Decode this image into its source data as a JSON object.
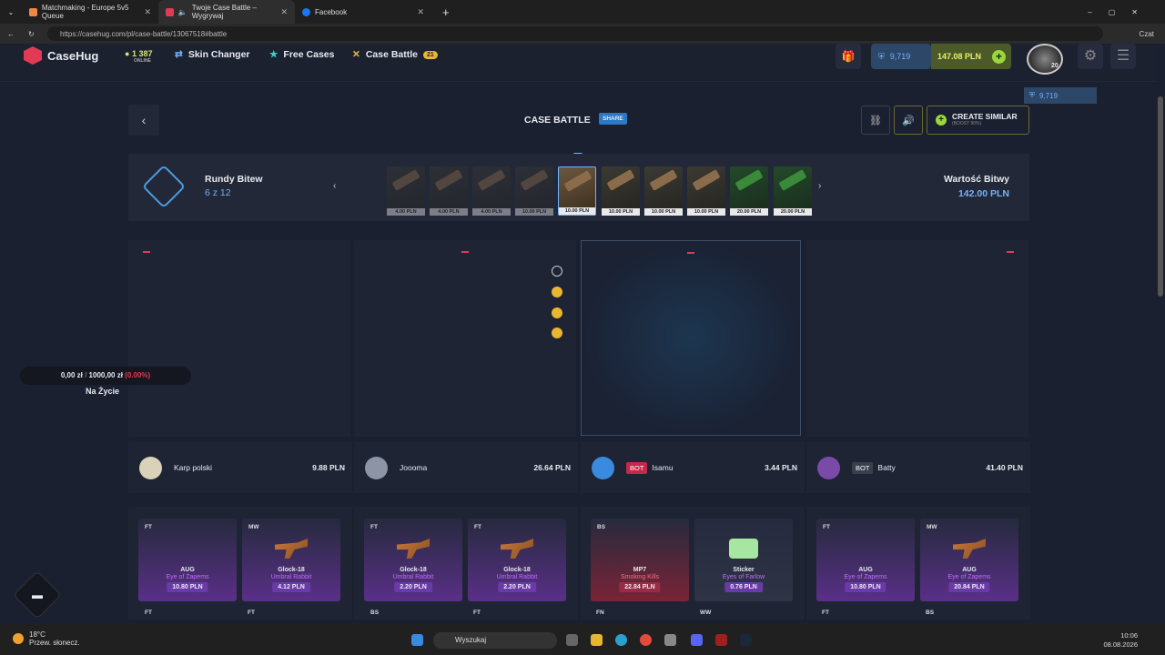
{
  "browser": {
    "tabs": [
      {
        "label": "Matchmaking - Europe 5v5 Queue"
      },
      {
        "label": "Twoje Case Battle – Wygrywaj"
      },
      {
        "label": "Facebook"
      }
    ],
    "url": "https://casehug.com/pl/case-battle/13067518#battle",
    "profile_label": "Czat",
    "new_tab": "+"
  },
  "header": {
    "logo": "CaseHug",
    "online_count": "1 387",
    "online_label": "ONLINE",
    "nav": [
      {
        "label": "Skin Changer"
      },
      {
        "label": "Free Cases"
      },
      {
        "label": "Case Battle",
        "badge": "21"
      }
    ],
    "coins": "9,719",
    "balance": "147.08 PLN",
    "level": "20"
  },
  "battle": {
    "title": "CASE BATTLE",
    "share": "SHARE",
    "create_similar": "CREATE SIMILAR",
    "boost": "(BOOST 90%)",
    "rounds_label": "Rundy Bitew",
    "rounds_count": "6 z 12",
    "value_label": "Wartość Bitwy",
    "value": "142.00 PLN",
    "cases": [
      {
        "price": "4.00 PLN"
      },
      {
        "price": "4.00 PLN"
      },
      {
        "price": "4.00 PLN"
      },
      {
        "price": "10.00 PLN"
      },
      {
        "price": "10.00 PLN"
      },
      {
        "price": "10.00 PLN"
      },
      {
        "price": "10.00 PLN"
      },
      {
        "price": "10.00 PLN"
      },
      {
        "price": "20.00 PLN"
      },
      {
        "price": "20.00 PLN"
      }
    ],
    "life_current": "0,00 zł",
    "life_sep": "/",
    "life_max": "1000,00 zł",
    "life_pct": "(0.00%)",
    "life_label": "Na Życie"
  },
  "players": [
    {
      "name": "Karp polski",
      "bot": "",
      "amount": "9.88 PLN",
      "color": "#d9d2b8"
    },
    {
      "name": "Joooma",
      "bot": "",
      "amount": "26.64 PLN",
      "color": "#8d94a5"
    },
    {
      "name": "Isamu",
      "bot": "BOT",
      "amount": "3.44 PLN",
      "color": "#3a8ae0"
    },
    {
      "name": "Batty",
      "bot": "BOT",
      "amount": "41.40 PLN",
      "color": "#7a4aa8"
    }
  ],
  "items": [
    [
      {
        "cond": "FT",
        "name": "AUG",
        "skin": "Eye of Zapems",
        "price": "10.80 PLN",
        "rarity": "pur",
        "art": "none"
      },
      {
        "cond": "MW",
        "name": "Glock-18",
        "skin": "Umbral Rabbit",
        "price": "4.12 PLN",
        "rarity": "pur",
        "art": "gun"
      }
    ],
    [
      {
        "cond": "FT",
        "name": "Glock-18",
        "skin": "Umbral Rabbit",
        "price": "2.20 PLN",
        "rarity": "pur",
        "art": "gun"
      },
      {
        "cond": "FT",
        "name": "Glock-18",
        "skin": "Umbral Rabbit",
        "price": "2.20 PLN",
        "rarity": "pur",
        "art": "gun"
      }
    ],
    [
      {
        "cond": "BS",
        "name": "MP7",
        "skin": "Smoking Kills",
        "price": "22.84 PLN",
        "rarity": "red",
        "art": "none"
      },
      {
        "cond": "",
        "name": "Sticker",
        "skin": "Eyes of Farlow",
        "price": "0.76 PLN",
        "rarity": "plain",
        "art": "sticker"
      }
    ],
    [
      {
        "cond": "FT",
        "name": "AUG",
        "skin": "Eye of Zapems",
        "price": "10.80 PLN",
        "rarity": "pur",
        "art": "none"
      },
      {
        "cond": "MW",
        "name": "AUG",
        "skin": "Eye of Zapems",
        "price": "20.84 PLN",
        "rarity": "pur",
        "art": "gun"
      }
    ]
  ],
  "next_row_conds": [
    "FT",
    "FT",
    "BS",
    "FT",
    "FN",
    "WW",
    "FT",
    "BS"
  ],
  "taskbar": {
    "temp": "18°C",
    "weather": "Przew. słonecz.",
    "search": "Wyszukaj",
    "time": "10:06",
    "date": "08.08.2026"
  }
}
